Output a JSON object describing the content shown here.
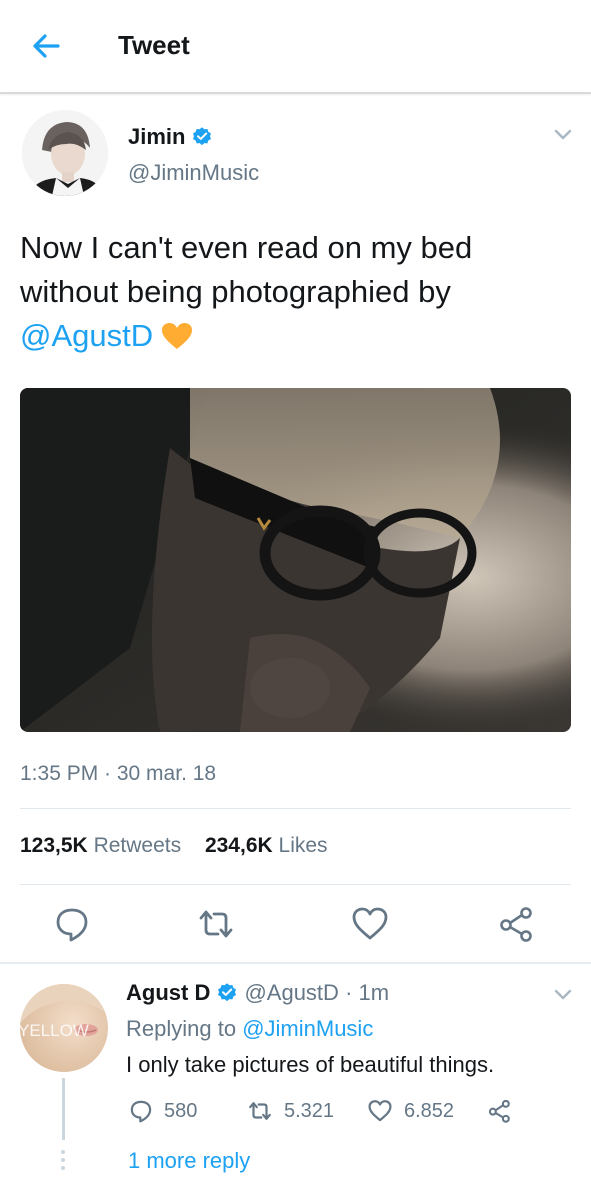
{
  "header": {
    "title": "Tweet"
  },
  "tweet": {
    "author_name": "Jimin",
    "author_handle": "@JiminMusic",
    "text_line1": "Now I can't even read on my bed",
    "text_line2": "without being photographied by",
    "mention": "@AgustD",
    "timestamp": "1:35 PM · 30 mar. 18",
    "retweets_count": "123,5K",
    "retweets_label": "Retweets",
    "likes_count": "234,6K",
    "likes_label": "Likes"
  },
  "reply": {
    "author_name": "Agust D",
    "author_handle": "@AgustD",
    "time": "· 1m",
    "replying_prefix": "Replying to",
    "replying_to": "@JiminMusic",
    "text": "I only take pictures of beautiful things.",
    "reply_count": "580",
    "retweet_count": "5.321",
    "like_count": "6.852",
    "more_replies": "1 more reply",
    "avatar_text": "YELLOW"
  },
  "colors": {
    "accent": "#1da1f2",
    "secondary_text": "#657786",
    "heart_emoji": "#ffac33"
  },
  "icons": [
    "back-arrow-icon",
    "verified-badge-icon",
    "chevron-down-icon",
    "yellow-heart-icon",
    "reply-icon",
    "retweet-icon",
    "like-icon",
    "share-icon"
  ]
}
